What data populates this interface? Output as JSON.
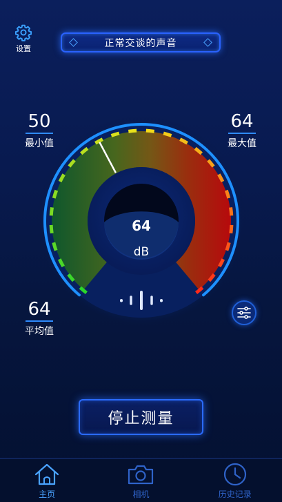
{
  "settings": {
    "label": "设置",
    "icon": "gear-icon"
  },
  "banner": {
    "text": "正常交谈的声音"
  },
  "stats": {
    "min": {
      "value": "50",
      "label": "最小值"
    },
    "max": {
      "value": "64",
      "label": "最大值"
    },
    "avg": {
      "value": "64",
      "label": "平均值"
    }
  },
  "gauge": {
    "reading": "64",
    "unit": "dB",
    "level_fraction": 0.4,
    "colors": {
      "low": "#2bd62b",
      "mid": "#f2e21a",
      "high": "#ff2a1a",
      "ring": "#1e90ff"
    }
  },
  "buttons": {
    "stop": "停止测量"
  },
  "nav": {
    "tabs": [
      {
        "label": "主页",
        "icon": "home-icon",
        "active": true
      },
      {
        "label": "相机",
        "icon": "camera-icon",
        "active": false
      },
      {
        "label": "历史记录",
        "icon": "clock-icon",
        "active": false
      }
    ]
  }
}
